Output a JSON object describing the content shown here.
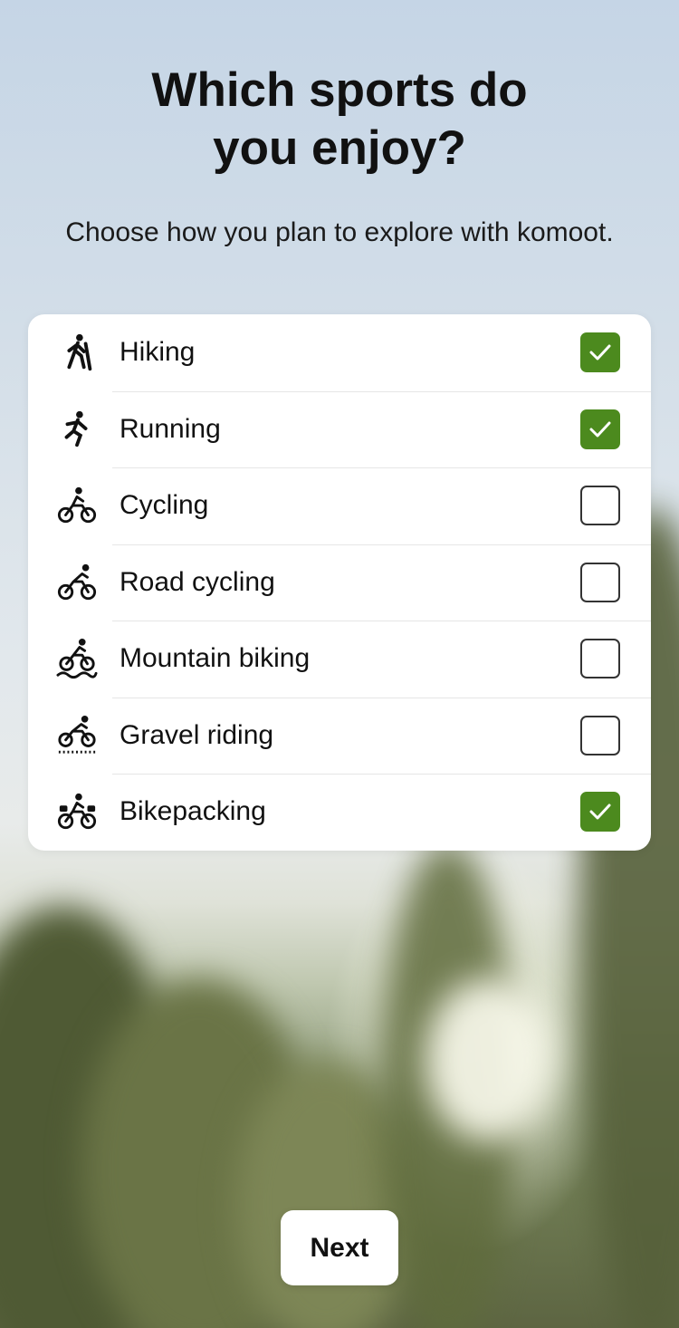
{
  "header": {
    "title": "Which sports do\nyou enjoy?",
    "subtitle": "Choose how you plan to explore with komoot."
  },
  "sports": [
    {
      "label": "Hiking",
      "icon": "hiking-icon",
      "checked": true
    },
    {
      "label": "Running",
      "icon": "running-icon",
      "checked": true
    },
    {
      "label": "Cycling",
      "icon": "cycling-icon",
      "checked": false
    },
    {
      "label": "Road cycling",
      "icon": "road-cycling-icon",
      "checked": false
    },
    {
      "label": "Mountain biking",
      "icon": "mountain-biking-icon",
      "checked": false
    },
    {
      "label": "Gravel riding",
      "icon": "gravel-riding-icon",
      "checked": false
    },
    {
      "label": "Bikepacking",
      "icon": "bikepacking-icon",
      "checked": true
    }
  ],
  "footer": {
    "next_label": "Next"
  },
  "colors": {
    "accent": "#4c8a1e"
  }
}
